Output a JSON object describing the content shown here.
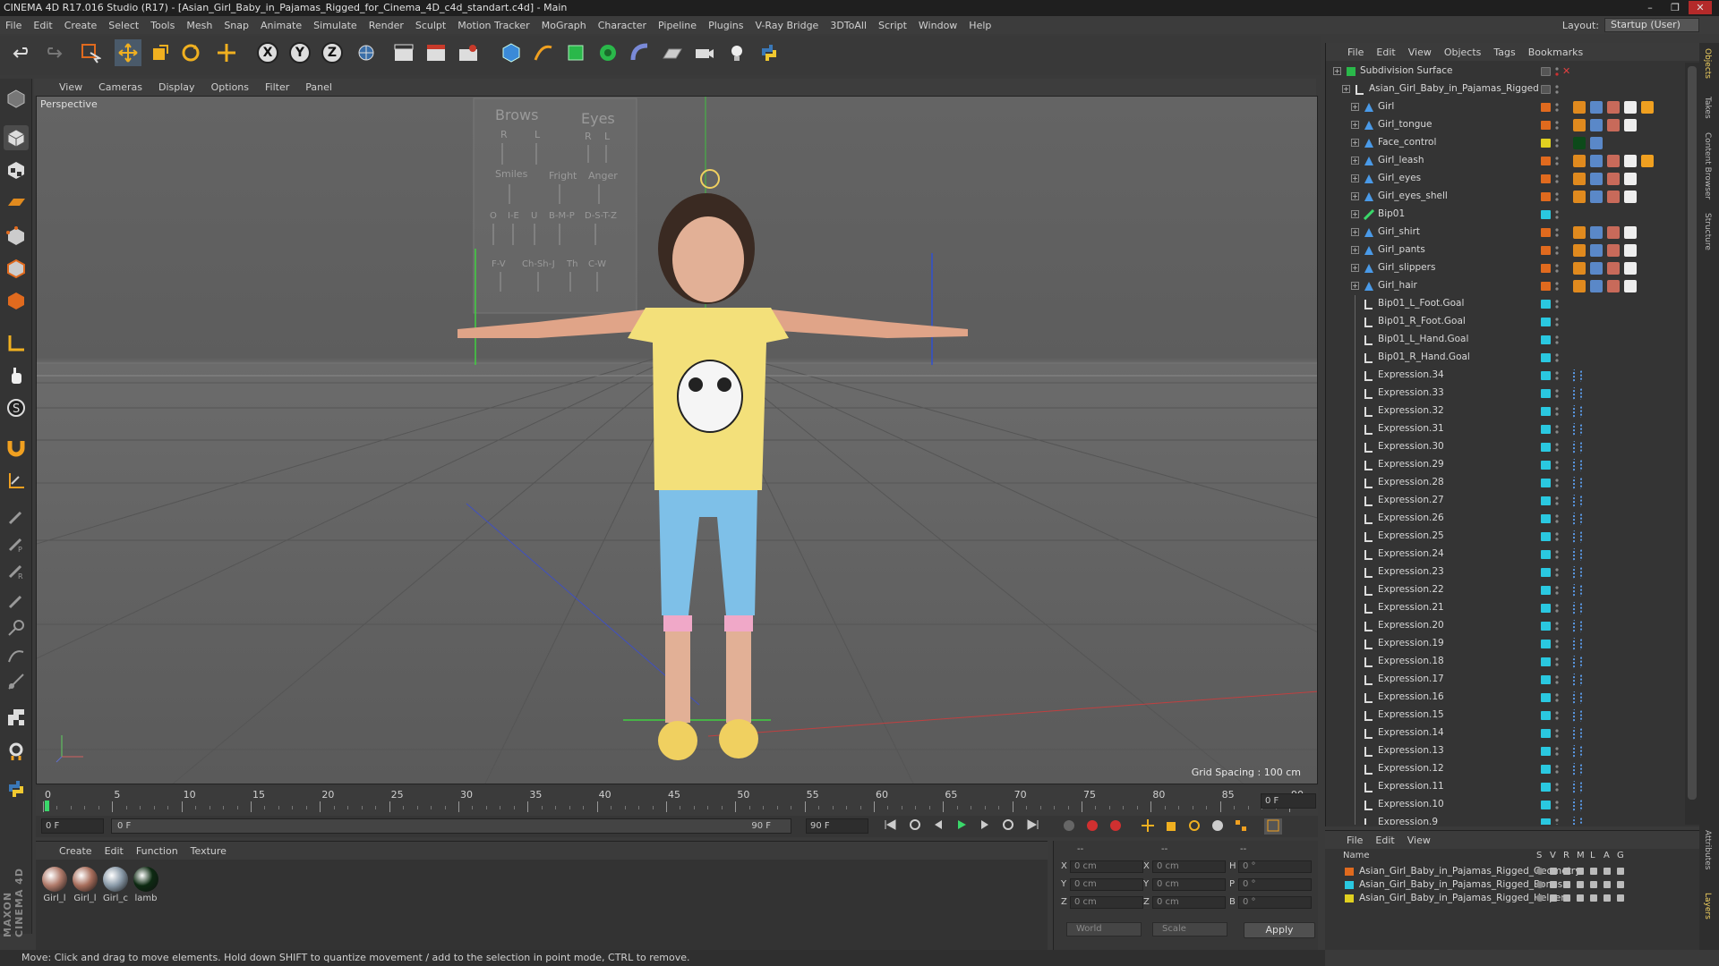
{
  "window": {
    "title": "CINEMA 4D R17.016 Studio (R17) - [Asian_Girl_Baby_in_Pajamas_Rigged_for_Cinema_4D_c4d_standart.c4d] - Main",
    "min": "–",
    "max": "❐",
    "close": "✕"
  },
  "menu": [
    "File",
    "Edit",
    "Create",
    "Select",
    "Tools",
    "Mesh",
    "Snap",
    "Animate",
    "Simulate",
    "Render",
    "Sculpt",
    "Motion Tracker",
    "MoGraph",
    "Character",
    "Pipeline",
    "Plugins",
    "V-Ray Bridge",
    "3DToAll",
    "Script",
    "Window",
    "Help"
  ],
  "layout": {
    "label": "Layout:",
    "value": "Startup (User)"
  },
  "toolbar": {
    "x": "X",
    "y": "Y",
    "z": "Z"
  },
  "viewport": {
    "menu": [
      "View",
      "Cameras",
      "Display",
      "Options",
      "Filter",
      "Panel"
    ],
    "label": "Perspective",
    "grid_spacing": "Grid Spacing : 100 cm",
    "face_panel": {
      "brows": "Brows",
      "eyes": "Eyes",
      "r1": "R",
      "l1": "L",
      "r2": "R",
      "l2": "L",
      "smiles": "Smiles",
      "fright": "Fright",
      "anger": "Anger",
      "row3": [
        "O",
        "I-E",
        "U",
        "B-M-P",
        "D-S-T-Z"
      ],
      "row4": [
        "F-V",
        "Ch-Sh-J",
        "Th",
        "C-W"
      ]
    }
  },
  "timeline": {
    "ticks": [
      "0",
      "5",
      "10",
      "15",
      "20",
      "25",
      "30",
      "35",
      "40",
      "45",
      "50",
      "55",
      "60",
      "65",
      "70",
      "75",
      "80",
      "85",
      "90"
    ],
    "current_frame": "0 F",
    "start_field": "0 F",
    "range_start": "0 F",
    "range_end": "90 F",
    "end_field": "90 F"
  },
  "materials": {
    "menu": [
      "Create",
      "Edit",
      "Function",
      "Texture"
    ],
    "items": [
      {
        "name": "Girl_l",
        "color": "#b07a6a"
      },
      {
        "name": "Girl_l",
        "color": "#a86e5c"
      },
      {
        "name": "Girl_c",
        "color": "#8a9aa8"
      },
      {
        "name": "lamb",
        "color": "#0d2a12"
      }
    ]
  },
  "coords": {
    "header": [
      "--",
      "--",
      "--"
    ],
    "rows": [
      {
        "a": "X",
        "av": "0 cm",
        "b": "X",
        "bv": "0 cm",
        "c": "H",
        "cv": "0 °"
      },
      {
        "a": "Y",
        "av": "0 cm",
        "b": "Y",
        "bv": "0 cm",
        "c": "P",
        "cv": "0 °"
      },
      {
        "a": "Z",
        "av": "0 cm",
        "b": "Z",
        "bv": "0 cm",
        "c": "B",
        "cv": "0 °"
      }
    ],
    "world": "World",
    "scale": "Scale",
    "apply": "Apply"
  },
  "status": "Move: Click and drag to move elements. Hold down SHIFT to quantize movement / add to the selection in point mode, CTRL to remove.",
  "objects": {
    "menu": [
      "File",
      "Edit",
      "View",
      "Objects",
      "Tags",
      "Bookmarks"
    ],
    "rows": [
      {
        "name": "Subdivision Surface",
        "indent": 0,
        "type": "subdiv",
        "color": "",
        "tags": 0
      },
      {
        "name": "Asian_Girl_Baby_in_Pajamas_Rigged",
        "indent": 1,
        "type": "null",
        "color": "",
        "tags": 0
      },
      {
        "name": "Girl",
        "indent": 2,
        "type": "mesh",
        "color": "#e06a1e",
        "tags": 5
      },
      {
        "name": "Girl_tongue",
        "indent": 2,
        "type": "mesh",
        "color": "#e06a1e",
        "tags": 4
      },
      {
        "name": "Face_control",
        "indent": 2,
        "type": "mesh",
        "color": "#e0d020",
        "tags": 2
      },
      {
        "name": "Girl_leash",
        "indent": 2,
        "type": "mesh",
        "color": "#e06a1e",
        "tags": 5
      },
      {
        "name": "Girl_eyes",
        "indent": 2,
        "type": "mesh",
        "color": "#e06a1e",
        "tags": 4
      },
      {
        "name": "Girl_eyes_shell",
        "indent": 2,
        "type": "mesh",
        "color": "#e06a1e",
        "tags": 4
      },
      {
        "name": "Bip01",
        "indent": 2,
        "type": "bone",
        "color": "#2ac8e0",
        "tags": 0
      },
      {
        "name": "Girl_shirt",
        "indent": 2,
        "type": "mesh",
        "color": "#e06a1e",
        "tags": 4
      },
      {
        "name": "Girl_pants",
        "indent": 2,
        "type": "mesh",
        "color": "#e06a1e",
        "tags": 4
      },
      {
        "name": "Girl_slippers",
        "indent": 2,
        "type": "mesh",
        "color": "#e06a1e",
        "tags": 4
      },
      {
        "name": "Girl_hair",
        "indent": 2,
        "type": "mesh",
        "color": "#e06a1e",
        "tags": 4
      },
      {
        "name": "Bip01_L_Foot.Goal",
        "indent": 2,
        "type": "null",
        "color": "#2ac8e0",
        "tags": 0
      },
      {
        "name": "Bip01_R_Foot.Goal",
        "indent": 2,
        "type": "null",
        "color": "#2ac8e0",
        "tags": 0
      },
      {
        "name": "Bip01_L_Hand.Goal",
        "indent": 2,
        "type": "null",
        "color": "#2ac8e0",
        "tags": 0
      },
      {
        "name": "Bip01_R_Hand.Goal",
        "indent": 2,
        "type": "null",
        "color": "#2ac8e0",
        "tags": 0
      },
      {
        "name": "Expression.34",
        "indent": 2,
        "type": "null",
        "color": "#2ac8e0",
        "tags": 1
      },
      {
        "name": "Expression.33",
        "indent": 2,
        "type": "null",
        "color": "#2ac8e0",
        "tags": 1
      },
      {
        "name": "Expression.32",
        "indent": 2,
        "type": "null",
        "color": "#2ac8e0",
        "tags": 1
      },
      {
        "name": "Expression.31",
        "indent": 2,
        "type": "null",
        "color": "#2ac8e0",
        "tags": 1
      },
      {
        "name": "Expression.30",
        "indent": 2,
        "type": "null",
        "color": "#2ac8e0",
        "tags": 1
      },
      {
        "name": "Expression.29",
        "indent": 2,
        "type": "null",
        "color": "#2ac8e0",
        "tags": 1
      },
      {
        "name": "Expression.28",
        "indent": 2,
        "type": "null",
        "color": "#2ac8e0",
        "tags": 1
      },
      {
        "name": "Expression.27",
        "indent": 2,
        "type": "null",
        "color": "#2ac8e0",
        "tags": 1
      },
      {
        "name": "Expression.26",
        "indent": 2,
        "type": "null",
        "color": "#2ac8e0",
        "tags": 1
      },
      {
        "name": "Expression.25",
        "indent": 2,
        "type": "null",
        "color": "#2ac8e0",
        "tags": 1
      },
      {
        "name": "Expression.24",
        "indent": 2,
        "type": "null",
        "color": "#2ac8e0",
        "tags": 1
      },
      {
        "name": "Expression.23",
        "indent": 2,
        "type": "null",
        "color": "#2ac8e0",
        "tags": 1
      },
      {
        "name": "Expression.22",
        "indent": 2,
        "type": "null",
        "color": "#2ac8e0",
        "tags": 1
      },
      {
        "name": "Expression.21",
        "indent": 2,
        "type": "null",
        "color": "#2ac8e0",
        "tags": 1
      },
      {
        "name": "Expression.20",
        "indent": 2,
        "type": "null",
        "color": "#2ac8e0",
        "tags": 1
      },
      {
        "name": "Expression.19",
        "indent": 2,
        "type": "null",
        "color": "#2ac8e0",
        "tags": 1
      },
      {
        "name": "Expression.18",
        "indent": 2,
        "type": "null",
        "color": "#2ac8e0",
        "tags": 1
      },
      {
        "name": "Expression.17",
        "indent": 2,
        "type": "null",
        "color": "#2ac8e0",
        "tags": 1
      },
      {
        "name": "Expression.16",
        "indent": 2,
        "type": "null",
        "color": "#2ac8e0",
        "tags": 1
      },
      {
        "name": "Expression.15",
        "indent": 2,
        "type": "null",
        "color": "#2ac8e0",
        "tags": 1
      },
      {
        "name": "Expression.14",
        "indent": 2,
        "type": "null",
        "color": "#2ac8e0",
        "tags": 1
      },
      {
        "name": "Expression.13",
        "indent": 2,
        "type": "null",
        "color": "#2ac8e0",
        "tags": 1
      },
      {
        "name": "Expression.12",
        "indent": 2,
        "type": "null",
        "color": "#2ac8e0",
        "tags": 1
      },
      {
        "name": "Expression.11",
        "indent": 2,
        "type": "null",
        "color": "#2ac8e0",
        "tags": 1
      },
      {
        "name": "Expression.10",
        "indent": 2,
        "type": "null",
        "color": "#2ac8e0",
        "tags": 1
      },
      {
        "name": "Expression.9",
        "indent": 2,
        "type": "null",
        "color": "#2ac8e0",
        "tags": 1
      }
    ]
  },
  "layers": {
    "menu": [
      "File",
      "Edit",
      "View"
    ],
    "head_name": "Name",
    "head_cols": [
      "S",
      "V",
      "R",
      "M",
      "L",
      "A",
      "G"
    ],
    "rows": [
      {
        "name": "Asian_Girl_Baby_in_Pajamas_Rigged_Geometry",
        "color": "#e06a1e"
      },
      {
        "name": "Asian_Girl_Baby_in_Pajamas_Rigged_Bones",
        "color": "#2ac8e0"
      },
      {
        "name": "Asian_Girl_Baby_in_Pajamas_Rigged_Helpers",
        "color": "#e0d020"
      }
    ]
  },
  "side_tabs": [
    "Objects",
    "Takes",
    "Content Browser",
    "Structure"
  ],
  "side_tabs_bottom": [
    "Attributes",
    "Layers"
  ],
  "brand": "MAXON CINEMA 4D"
}
